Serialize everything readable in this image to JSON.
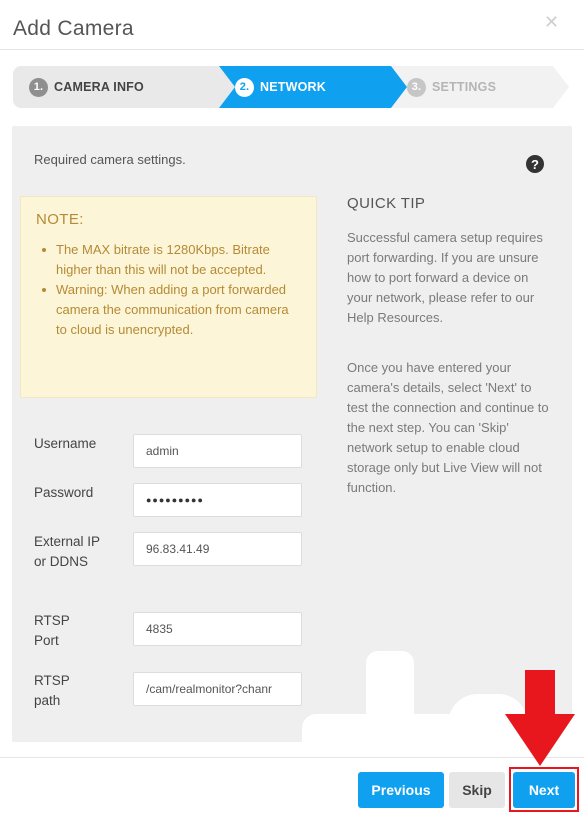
{
  "dialog": {
    "title": "Add Camera"
  },
  "steps": [
    {
      "number": "1.",
      "label": "CAMERA INFO"
    },
    {
      "number": "2.",
      "label": "NETWORK"
    },
    {
      "number": "3.",
      "label": "SETTINGS"
    }
  ],
  "panel": {
    "required_text": "Required camera settings.",
    "help_glyph": "?"
  },
  "note": {
    "title": "NOTE:",
    "items": [
      "The MAX bitrate is 1280Kbps. Bitrate higher than this will not be accepted.",
      "Warning: When adding a port forwarded camera the communication from camera to cloud is unencrypted."
    ]
  },
  "quick_tip": {
    "title": "QUICK TIP",
    "paragraphs": [
      "Successful camera setup requires port forwarding. If you are unsure how to port forward a device on your network, please refer to our Help Resources.",
      "Once you have entered your camera's details, select 'Next' to test the connection and continue to the next step. You can 'Skip' network setup to enable cloud storage only but Live View will not function."
    ]
  },
  "form": {
    "username": {
      "label": "Username",
      "value": "admin"
    },
    "password": {
      "label": "Password",
      "value": "●●●●●●●●●"
    },
    "external_ip": {
      "label": "External IP or DDNS",
      "value": "96.83.41.49"
    },
    "rtsp_port": {
      "label": "RTSP Port",
      "value": "4835"
    },
    "rtsp_path": {
      "label": "RTSP path",
      "value": "/cam/realmonitor?chanr"
    }
  },
  "buttons": {
    "previous": "Previous",
    "skip": "Skip",
    "next": "Next"
  },
  "icons": {
    "close": "close-icon",
    "help": "question-circle-icon",
    "annotation_arrow": "red-arrow-down-icon"
  },
  "colors": {
    "accent": "#0fa0f0",
    "note_bg": "#fdf5d7",
    "note_text": "#b58a36",
    "annotation": "#e8171d"
  }
}
